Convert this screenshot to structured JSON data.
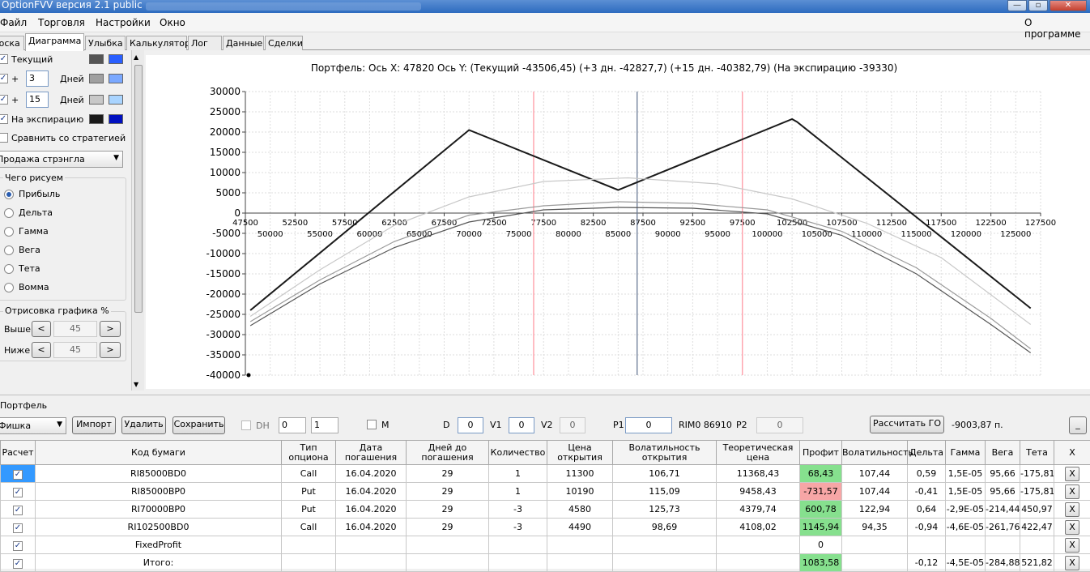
{
  "window": {
    "title": "OptionFVV версия 2.1 public",
    "controls": [
      "—",
      "▫",
      "✕"
    ]
  },
  "menu": [
    "Файл",
    "Торговля",
    "Настройки",
    "Окно"
  ],
  "about": "О программе",
  "tabs": [
    "Доска",
    "Диаграмма",
    "Улыбка",
    "Калькулятор",
    "Лог",
    "Данные",
    "Сделки"
  ],
  "active_tab": "Диаграмма",
  "left": {
    "current_label": "Текущий",
    "days1_prefix": "+",
    "days1_value": "3",
    "days_label": "Дней",
    "days2_prefix": "+",
    "days2_value": "15",
    "expiry_label": "На экспирацию",
    "compare_label": "Сравнить со стратегией",
    "strategy": "Продажа стрэнгла",
    "group_title": "Чего рисуем",
    "radios": [
      "Прибыль",
      "Дельта",
      "Гамма",
      "Вега",
      "Тета",
      "Вомма"
    ],
    "selected_radio": "Прибыль",
    "draw_title": "Отрисовка графика %",
    "above_label": "Выше",
    "above_value": "45",
    "below_label": "Ниже",
    "below_value": "45",
    "colors": {
      "current": [
        "#555555",
        "#2a5fff"
      ],
      "d3": [
        "#a0a0a0",
        "#7aa8ff"
      ],
      "d15": [
        "#c8c8c8",
        "#a9d4ff"
      ],
      "exp": [
        "#1a1a1a",
        "#0010c0"
      ]
    }
  },
  "chart_header": "Портфель: Ось X: 47820 Ось Y: (Текущий -43506,45) (+3 дн. -42827,7) (+15 дн. -40382,79) (На экспирацию -39330)",
  "chart_data": {
    "type": "line",
    "title": "",
    "xlim": [
      47500,
      127500
    ],
    "ylim": [
      -40000,
      30000
    ],
    "x_ticks_top": [
      "47500",
      "52500",
      "57500",
      "62500",
      "67500",
      "72500",
      "77500",
      "82500",
      "87500",
      "92500",
      "97500",
      "102500",
      "107500",
      "112500",
      "117500",
      "122500",
      "127500"
    ],
    "x_ticks_bottom": [
      "50000",
      "55000",
      "60000",
      "65000",
      "70000",
      "75000",
      "80000",
      "85000",
      "90000",
      "95000",
      "100000",
      "105000",
      "110000",
      "115000",
      "120000",
      "125000"
    ],
    "y_ticks": [
      "30000",
      "25000",
      "20000",
      "15000",
      "10000",
      "5000",
      "0",
      "-5000",
      "-10000",
      "-15000",
      "-20000",
      "-25000",
      "-30000",
      "-35000",
      "-40000"
    ],
    "vertical_lines": [
      {
        "x": 76500,
        "color": "#ff9aa5"
      },
      {
        "x": 86910,
        "color": "#6a7a96"
      },
      {
        "x": 97500,
        "color": "#ff9aa5"
      }
    ],
    "series": [
      {
        "name": "На экспирацию",
        "color": "#1a1a1a",
        "width": 2,
        "x": [
          48000,
          70000,
          85000,
          102500,
          103000,
          126500
        ],
        "y": [
          -24000,
          20500,
          5700,
          23200,
          22500,
          -23500
        ]
      },
      {
        "name": "+15 дн.",
        "color": "#c8c8c8",
        "width": 1.2,
        "x": [
          48000,
          55000,
          62500,
          70000,
          77500,
          86000,
          95000,
          102500,
          110000,
          117500,
          126500
        ],
        "y": [
          -25500,
          -14000,
          -3000,
          4000,
          7800,
          8700,
          7200,
          3500,
          -2500,
          -11000,
          -27500
        ]
      },
      {
        "name": "+3 дн.",
        "color": "#9a9a9a",
        "width": 1.2,
        "x": [
          48000,
          55000,
          62500,
          70000,
          77500,
          85000,
          92500,
          100000,
          107500,
          115000,
          122500,
          126500
        ],
        "y": [
          -26800,
          -16500,
          -7000,
          -500,
          1800,
          2800,
          2400,
          800,
          -4500,
          -13500,
          -26000,
          -33500
        ]
      },
      {
        "name": "Текущий",
        "color": "#555555",
        "width": 1.2,
        "x": [
          48000,
          55000,
          62500,
          70000,
          77500,
          85000,
          92500,
          100000,
          107500,
          115000,
          122500,
          126500
        ],
        "y": [
          -27800,
          -17500,
          -8500,
          -2200,
          800,
          1400,
          1200,
          -200,
          -5500,
          -15000,
          -27500,
          -34500
        ]
      }
    ]
  },
  "portfolio": {
    "title": "Портфель",
    "combo": "Фишка",
    "import": "Импорт",
    "delete": "Удалить",
    "save": "Сохранить",
    "dh_label": "DH",
    "dh_v1": "0",
    "dh_v2": "1",
    "m_label": "M",
    "d_label": "D",
    "d_value": "0",
    "v1_label": "V1",
    "v1_value": "0",
    "v2_label": "V2",
    "v2_value": "0",
    "p1_label": "P1",
    "p1_value": "0",
    "instrument": "RIM0 86910",
    "p2_label": "P2",
    "p2_value": "0",
    "calc_go": "Рассчитать ГО",
    "go_value": "-9003,87 п.",
    "collapse": "_"
  },
  "table": {
    "headers": [
      "Расчет",
      "Код бумаги",
      "Тип опциона",
      "Дата погашения",
      "Дней до погашения",
      "Количество",
      "Цена открытия",
      "Волатильность открытия",
      "Теоретическая цена",
      "Профит",
      "Волатильность",
      "Дельта",
      "Гамма",
      "Вега",
      "Тета",
      "X"
    ],
    "rows": [
      {
        "code": "RI85000BD0",
        "type": "Call",
        "date": "16.04.2020",
        "days": "29",
        "qty": "1",
        "price": "11300",
        "vol_open": "106,71",
        "theo": "11368,43",
        "profit": "68,43",
        "pclass": "pos",
        "vol": "107,44",
        "delta": "0,59",
        "gamma": "1,5E-05",
        "vega": "95,66",
        "theta": "-175,81",
        "x": "X",
        "sel": true
      },
      {
        "code": "RI85000BP0",
        "type": "Put",
        "date": "16.04.2020",
        "days": "29",
        "qty": "1",
        "price": "10190",
        "vol_open": "115,09",
        "theo": "9458,43",
        "profit": "-731,57",
        "pclass": "neg",
        "vol": "107,44",
        "delta": "-0,41",
        "gamma": "1,5E-05",
        "vega": "95,66",
        "theta": "-175,81",
        "x": "X"
      },
      {
        "code": "RI70000BP0",
        "type": "Put",
        "date": "16.04.2020",
        "days": "29",
        "qty": "-3",
        "price": "4580",
        "vol_open": "125,73",
        "theo": "4379,74",
        "profit": "600,78",
        "pclass": "pos",
        "vol": "122,94",
        "delta": "0,64",
        "gamma": "-2,9E-05",
        "vega": "-214,44",
        "theta": "450,97",
        "x": "X"
      },
      {
        "code": "RI102500BD0",
        "type": "Call",
        "date": "16.04.2020",
        "days": "29",
        "qty": "-3",
        "price": "4490",
        "vol_open": "98,69",
        "theo": "4108,02",
        "profit": "1145,94",
        "pclass": "pos",
        "vol": "94,35",
        "delta": "-0,94",
        "gamma": "-4,6E-05",
        "vega": "-261,76",
        "theta": "422,47",
        "x": "X"
      },
      {
        "code": "FixedProfit",
        "type": "",
        "date": "",
        "days": "",
        "qty": "",
        "price": "",
        "vol_open": "",
        "theo": "",
        "profit": "0",
        "pclass": "",
        "vol": "",
        "delta": "",
        "gamma": "",
        "vega": "",
        "theta": "",
        "x": "X"
      },
      {
        "code": "Итого:",
        "type": "",
        "date": "",
        "days": "",
        "qty": "",
        "price": "",
        "vol_open": "",
        "theo": "",
        "profit": "1083,58",
        "pclass": "pos",
        "vol": "",
        "delta": "-0,12",
        "gamma": "-4,5E-05",
        "vega": "-284,88",
        "theta": "521,82",
        "x": "X"
      }
    ]
  }
}
